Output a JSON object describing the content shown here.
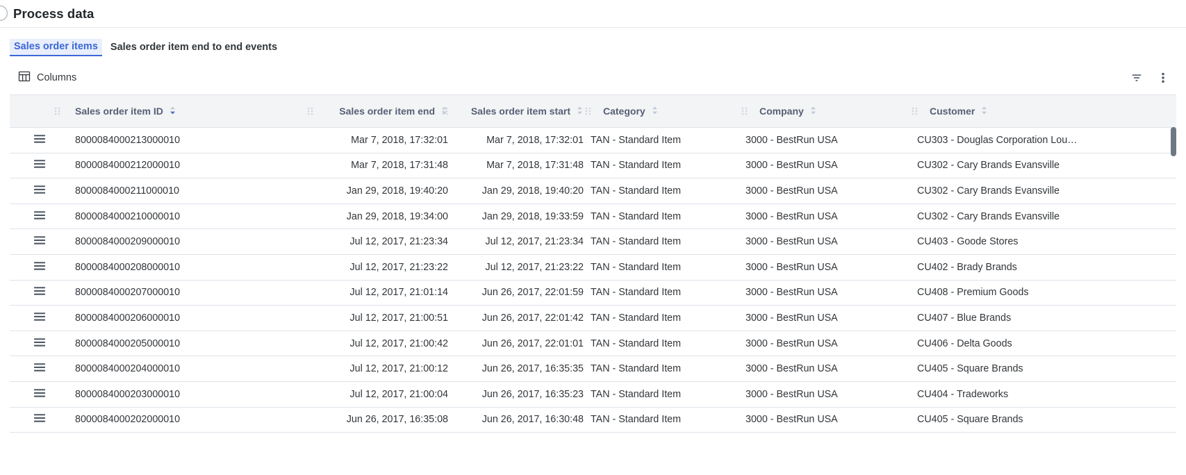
{
  "header": {
    "title": "Process data",
    "spinner_icon": "circle-spinner-icon"
  },
  "tabs": [
    {
      "label": "Sales order items",
      "active": true
    },
    {
      "label": "Sales order item end to end events",
      "active": false
    }
  ],
  "toolbar": {
    "columns_label": "Columns",
    "columns_icon": "table-columns-icon",
    "filter_icon": "filter-icon",
    "more_icon": "more-vertical-icon"
  },
  "table": {
    "columns": [
      {
        "key": "handle",
        "label": "",
        "sortable": false,
        "sorted": false
      },
      {
        "key": "id",
        "label": "Sales order item ID",
        "sortable": true,
        "sorted": true,
        "direction": "desc"
      },
      {
        "key": "end",
        "label": "Sales order item end",
        "sortable": true,
        "sorted": false
      },
      {
        "key": "start",
        "label": "Sales order item start",
        "sortable": true,
        "sorted": false
      },
      {
        "key": "category",
        "label": "Category",
        "sortable": true,
        "sorted": false
      },
      {
        "key": "company",
        "label": "Company",
        "sortable": true,
        "sorted": false
      },
      {
        "key": "customer",
        "label": "Customer",
        "sortable": true,
        "sorted": false
      }
    ],
    "rows": [
      {
        "id": "8000084000213000010",
        "end": "Mar 7, 2018, 17:32:01",
        "start": "Mar 7, 2018, 17:32:01",
        "category": "TAN - Standard Item",
        "company": "3000 - BestRun USA",
        "customer": "CU303 - Douglas Corporation Lou…"
      },
      {
        "id": "8000084000212000010",
        "end": "Mar 7, 2018, 17:31:48",
        "start": "Mar 7, 2018, 17:31:48",
        "category": "TAN - Standard Item",
        "company": "3000 - BestRun USA",
        "customer": "CU302 - Cary Brands Evansville"
      },
      {
        "id": "8000084000211000010",
        "end": "Jan 29, 2018, 19:40:20",
        "start": "Jan 29, 2018, 19:40:20",
        "category": "TAN - Standard Item",
        "company": "3000 - BestRun USA",
        "customer": "CU302 - Cary Brands Evansville"
      },
      {
        "id": "8000084000210000010",
        "end": "Jan 29, 2018, 19:34:00",
        "start": "Jan 29, 2018, 19:33:59",
        "category": "TAN - Standard Item",
        "company": "3000 - BestRun USA",
        "customer": "CU302 - Cary Brands Evansville"
      },
      {
        "id": "8000084000209000010",
        "end": "Jul 12, 2017, 21:23:34",
        "start": "Jul 12, 2017, 21:23:34",
        "category": "TAN - Standard Item",
        "company": "3000 - BestRun USA",
        "customer": "CU403 - Goode Stores"
      },
      {
        "id": "8000084000208000010",
        "end": "Jul 12, 2017, 21:23:22",
        "start": "Jul 12, 2017, 21:23:22",
        "category": "TAN - Standard Item",
        "company": "3000 - BestRun USA",
        "customer": "CU402 - Brady Brands"
      },
      {
        "id": "8000084000207000010",
        "end": "Jul 12, 2017, 21:01:14",
        "start": "Jun 26, 2017, 22:01:59",
        "category": "TAN - Standard Item",
        "company": "3000 - BestRun USA",
        "customer": "CU408 - Premium Goods"
      },
      {
        "id": "8000084000206000010",
        "end": "Jul 12, 2017, 21:00:51",
        "start": "Jun 26, 2017, 22:01:42",
        "category": "TAN - Standard Item",
        "company": "3000 - BestRun USA",
        "customer": "CU407 - Blue Brands"
      },
      {
        "id": "8000084000205000010",
        "end": "Jul 12, 2017, 21:00:42",
        "start": "Jun 26, 2017, 22:01:01",
        "category": "TAN - Standard Item",
        "company": "3000 - BestRun USA",
        "customer": "CU406 - Delta Goods"
      },
      {
        "id": "8000084000204000010",
        "end": "Jul 12, 2017, 21:00:12",
        "start": "Jun 26, 2017, 16:35:35",
        "category": "TAN - Standard Item",
        "company": "3000 - BestRun USA",
        "customer": "CU405 - Square Brands"
      },
      {
        "id": "8000084000203000010",
        "end": "Jul 12, 2017, 21:00:04",
        "start": "Jun 26, 2017, 16:35:23",
        "category": "TAN - Standard Item",
        "company": "3000 - BestRun USA",
        "customer": "CU404 - Tradeworks"
      },
      {
        "id": "8000084000202000010",
        "end": "Jun 26, 2017, 16:35:08",
        "start": "Jun 26, 2017, 16:30:48",
        "category": "TAN - Standard Item",
        "company": "3000 - BestRun USA",
        "customer": "CU405 - Square Brands"
      }
    ]
  },
  "colors": {
    "accent": "#3c68d6",
    "accent_bg": "#e8eefc",
    "header_bg": "#f3f4f6",
    "border": "#dde3ea",
    "text": "#32363a",
    "muted": "#556074",
    "scrollbar_thumb": "#6e7783"
  }
}
